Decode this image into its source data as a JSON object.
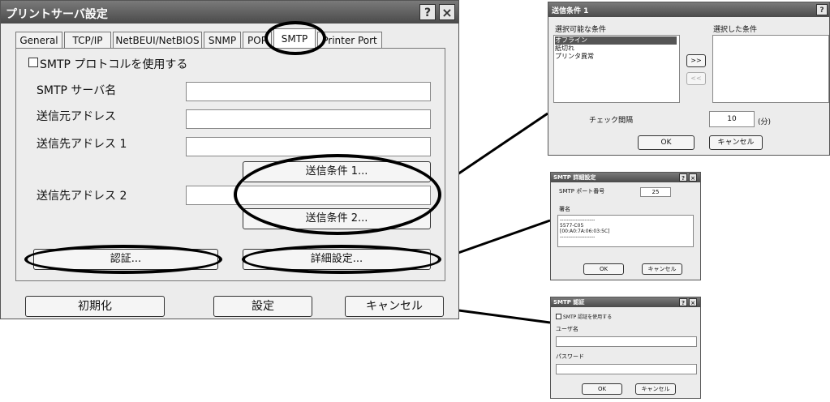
{
  "main": {
    "title": "プリントサーバ設定",
    "help_icon": "?",
    "close_icon": "×",
    "tabs": [
      "General",
      "TCP/IP",
      "NetBEUI/NetBIOS",
      "SNMP",
      "POP",
      "SMTP",
      "Printer Port"
    ],
    "use_smtp_label": "SMTP プロトコルを使用する",
    "smtp_server_label": "SMTP サーバ名",
    "from_label": "送信元アドレス",
    "to1_label": "送信先アドレス 1",
    "to2_label": "送信先アドレス 2",
    "cond1_button": "送信条件 1...",
    "cond2_button": "送信条件 2...",
    "auth_button": "認証...",
    "detail_button": "詳細設定...",
    "init_button": "初期化",
    "set_button": "設定",
    "cancel_button": "キャンセル"
  },
  "cond_dialog": {
    "title": "送信条件 1",
    "help_icon": "?",
    "available_label": "選択可能な条件",
    "selected_label": "選択した条件",
    "available_items": [
      "オフライン",
      "紙切れ",
      "プリンタ異常"
    ],
    "add_button": ">>",
    "remove_button": "<<",
    "interval_label": "チェック間隔",
    "interval_value": "10",
    "interval_unit": "(分)",
    "ok": "OK",
    "cancel": "キャンセル"
  },
  "detail_dialog": {
    "title": "SMTP 詳細設定",
    "help_icon": "?",
    "close_icon": "×",
    "port_label": "SMTP ポート番号",
    "port_value": "25",
    "signature_label": "署名",
    "signature_lines": [
      "--------------------",
      "5577-C05",
      "[00:A0:7A:06:03:5C]",
      "--------------------"
    ],
    "ok": "OK",
    "cancel": "キャンセル"
  },
  "auth_dialog": {
    "title": "SMTP 認証",
    "help_icon": "?",
    "close_icon": "×",
    "use_auth_label": "SMTP 認証を使用する",
    "user_label": "ユーザ名",
    "password_label": "パスワード",
    "ok": "OK",
    "cancel": "キャンセル"
  }
}
